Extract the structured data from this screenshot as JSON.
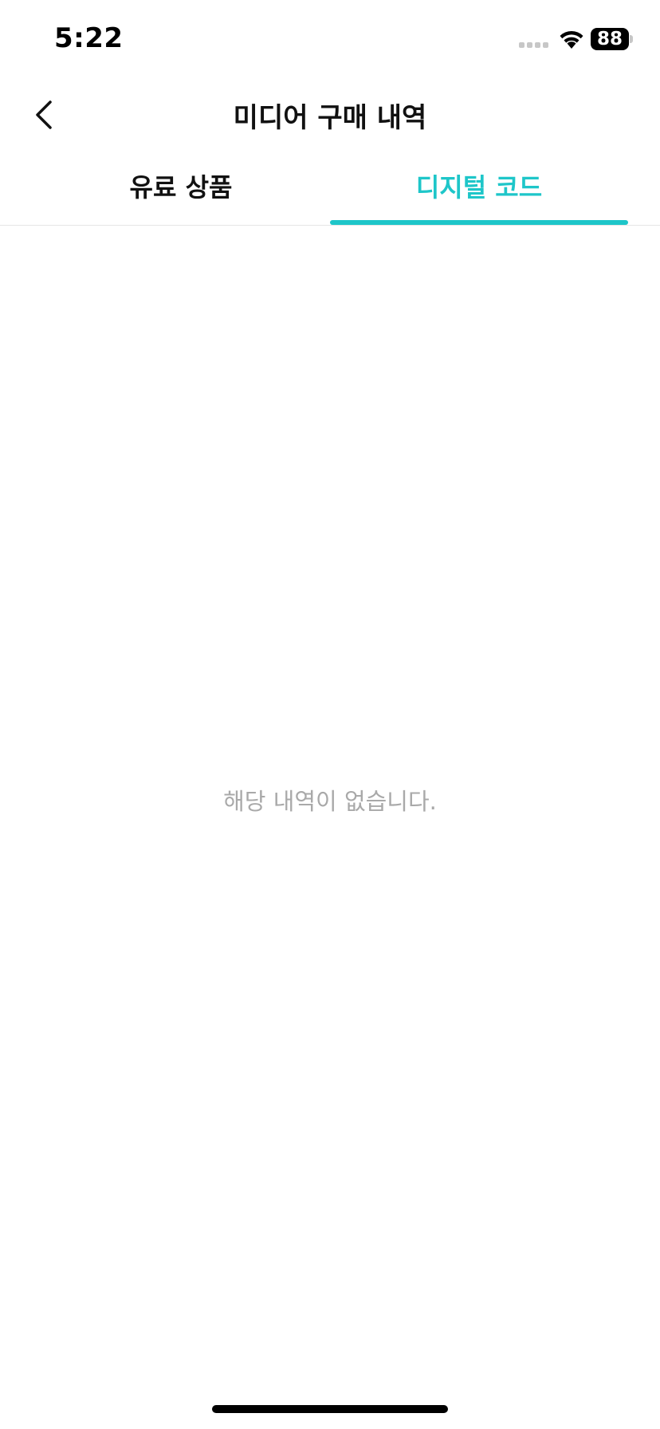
{
  "status_bar": {
    "time": "5:22",
    "battery": "88",
    "icons": [
      "cellular-signal-icon",
      "wifi-icon",
      "battery-icon"
    ]
  },
  "nav": {
    "back_icon": "chevron-left-icon",
    "title": "미디어 구매 내역"
  },
  "tabs": [
    {
      "label": "유료 상품",
      "selected": false
    },
    {
      "label": "디지털 코드",
      "selected": true
    }
  ],
  "empty_state": {
    "message": "해당 내역이 없습니다."
  },
  "colors": {
    "accent": "#1ec6c9",
    "text_primary": "#111111",
    "text_muted": "#a9a9a9",
    "background": "#ffffff"
  }
}
